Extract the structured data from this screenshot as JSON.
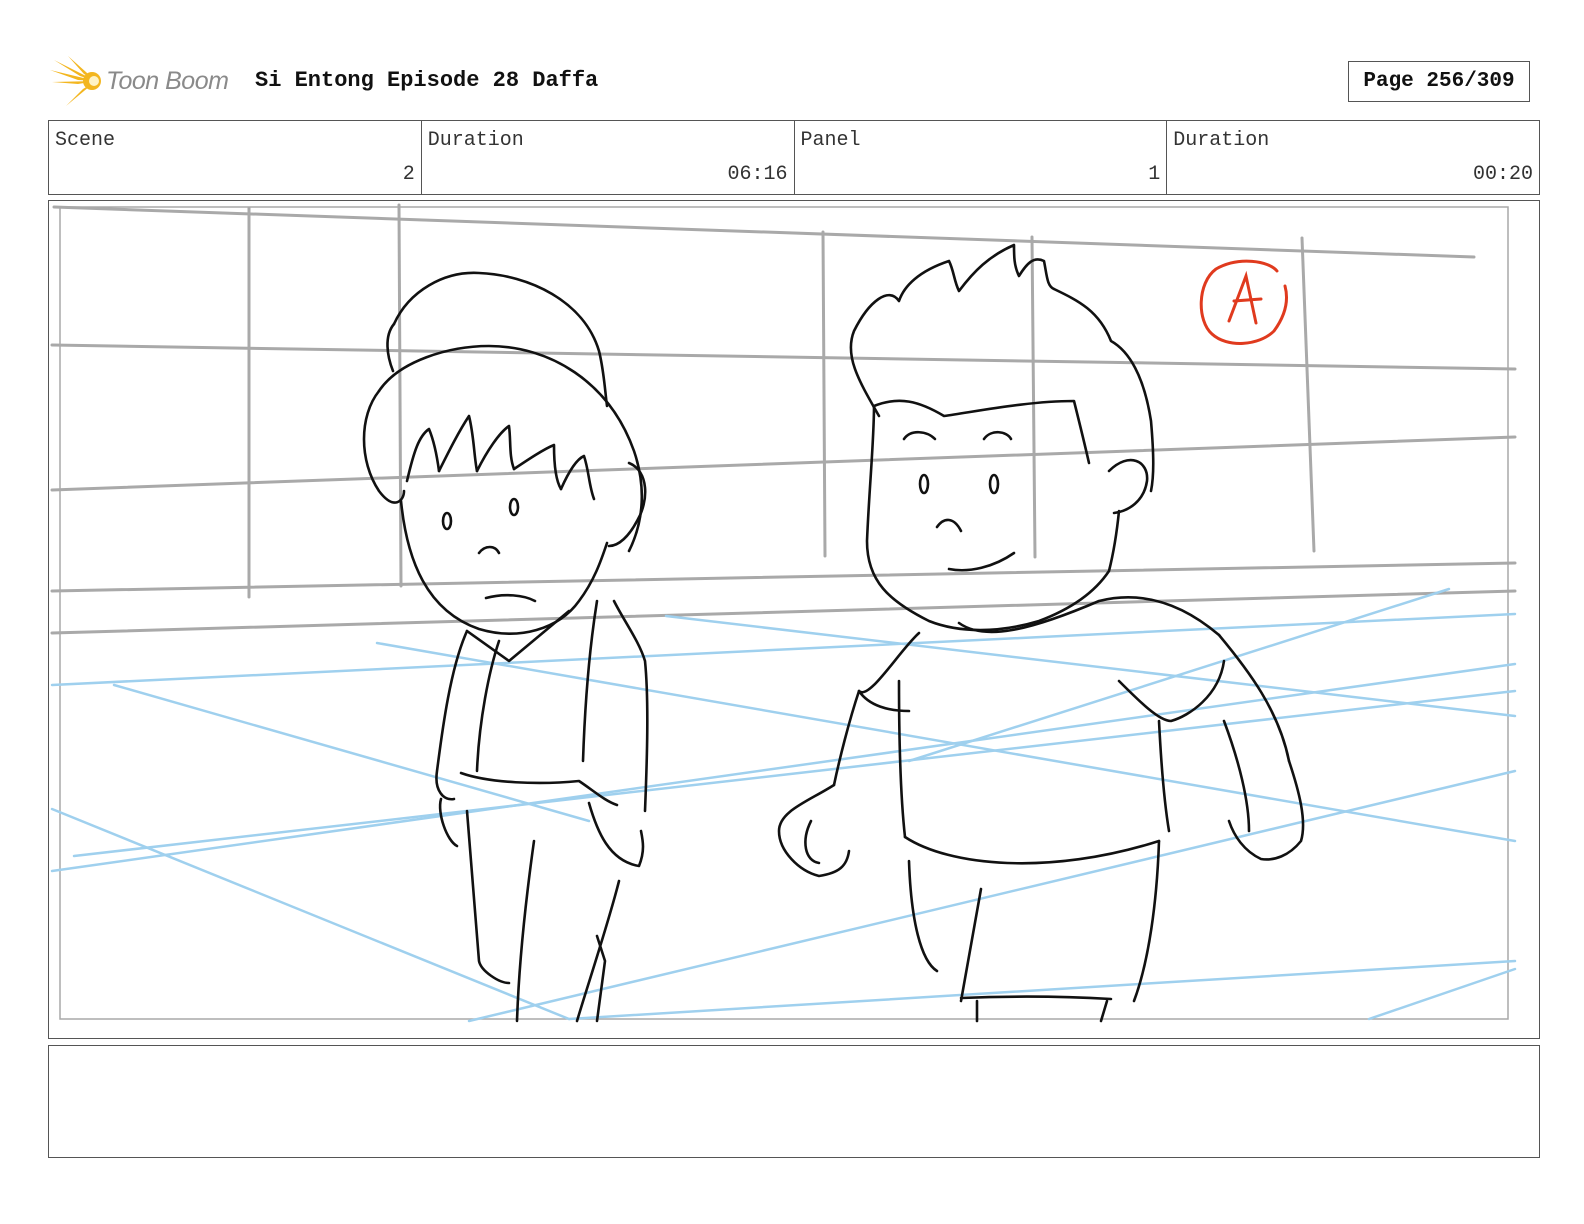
{
  "header": {
    "logo_text": "Toon Boom",
    "title": "Si Entong Episode 28 Daffa",
    "page": "Page 256/309"
  },
  "info": {
    "scene_label": "Scene",
    "scene_value": "2",
    "scene_duration_label": "Duration",
    "scene_duration_value": "06:16",
    "panel_label": "Panel",
    "panel_value": "1",
    "panel_duration_label": "Duration",
    "panel_duration_value": "00:20"
  },
  "panel": {
    "annotation_mark": "A",
    "colors": {
      "sketch": "#111111",
      "grid": "#a9a9a9",
      "floor_guides": "#9fd0ee",
      "annotation": "#e03a1e"
    }
  },
  "notes": {
    "text": ""
  },
  "logo_colors": {
    "star": "#f3b61f",
    "text": "#8a8a8a"
  }
}
